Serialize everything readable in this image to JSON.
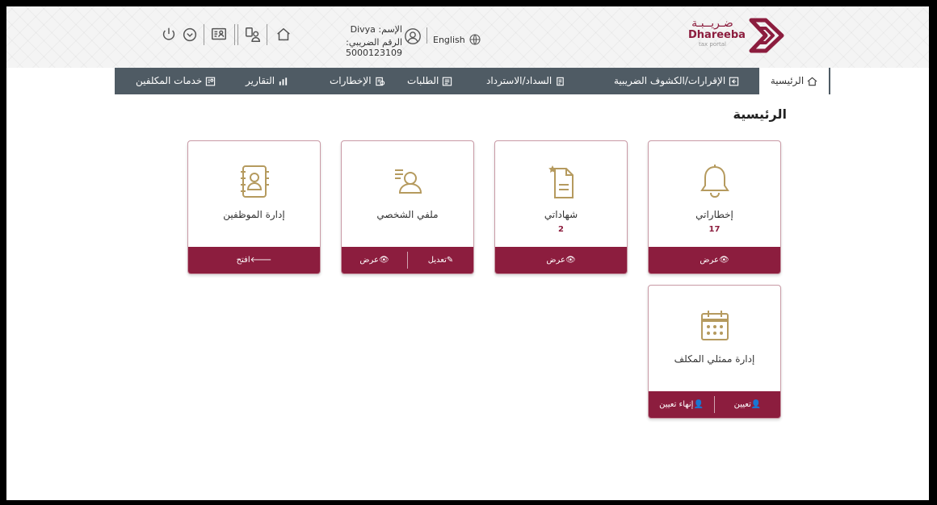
{
  "header": {
    "user_name": "الإسم: Divya",
    "tax_number": "الرقم الضريبي: 5000123109",
    "language_label": "English",
    "logo_arabic": "ضـريــبـة",
    "logo_english": "Dhareeba",
    "logo_sub": "tax portal"
  },
  "nav": {
    "home": "الرئيسية",
    "returns": "الإقرارات/الكشوف الضريبية",
    "payments": "السداد/الاسترداد",
    "requests": "الطلبات",
    "notifications": "الإخطارات",
    "reports": "التقارير",
    "taxpayer_services": "خدمات المكلفين"
  },
  "page": {
    "title": "الرئيسية"
  },
  "cards": {
    "notifications": {
      "title": "إخطاراتي",
      "count": "17",
      "view": "عرض"
    },
    "certificates": {
      "title": "شهاداتي",
      "count": "2",
      "view": "عرض"
    },
    "profile": {
      "title": "ملفي الشخصي",
      "edit": "تعديل",
      "view": "عرض"
    },
    "employees": {
      "title": "إدارة الموظفين",
      "open": "افتح"
    },
    "representatives": {
      "title": "إدارة ممثلي المكلف",
      "assign": "تعيين",
      "unassign": "إنهاء تعيين"
    }
  },
  "colors": {
    "brand": "#8c1d3e",
    "nav_bg": "#4f5b64",
    "icon_gold": "#b59a5e"
  }
}
